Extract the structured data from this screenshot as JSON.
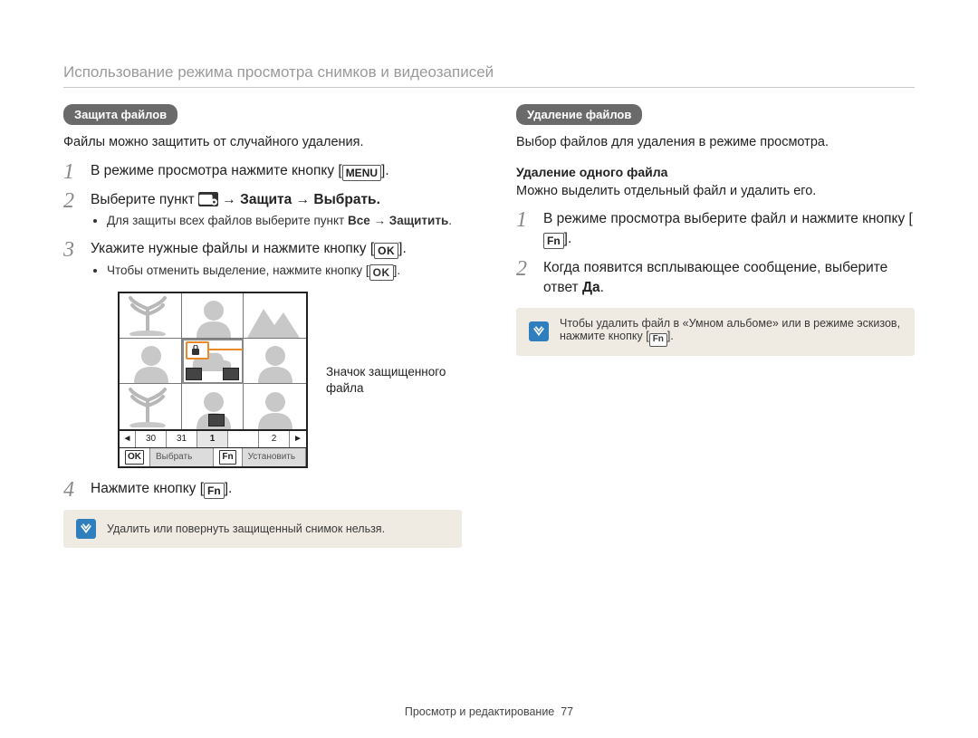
{
  "header": {
    "title": "Использование режима просмотра снимков и видеозаписей"
  },
  "left": {
    "pill": "Защита файлов",
    "intro": "Файлы можно защитить от случайного удаления.",
    "step1_a": "В режиме просмотра нажмите кнопку [",
    "step1_b": "].",
    "menu_label": "MENU",
    "step2_a": "Выберите пункт ",
    "step2_b": " → Защита → Выбрать.",
    "step2_sub_a": "Для защиты всех файлов выберите пункт ",
    "step2_sub_all": "Все",
    "step2_sub_arrow": " → ",
    "step2_sub_protect": "Защитить",
    "step2_sub_dot": ".",
    "step3_a": "Укажите нужные файлы и нажмите кнопку [",
    "step3_b": "].",
    "ok_label": "OK",
    "step3_sub_a": "Чтобы отменить выделение, нажмите кнопку [",
    "step3_sub_b": "].",
    "callout": "Значок защищенного файла",
    "timeline": {
      "t1": "30",
      "t2": "31",
      "t3": "1",
      "t4": "2"
    },
    "bar": {
      "ok": "OK",
      "select": "Выбрать",
      "fn": "Fn",
      "set": "Установить"
    },
    "step4_a": "Нажмите кнопку [",
    "step4_b": "].",
    "fn_label": "Fn",
    "note": "Удалить или повернуть защищенный снимок нельзя."
  },
  "right": {
    "pill": "Удаление файлов",
    "intro": "Выбор файлов для удаления в режиме просмотра.",
    "subhead": "Удаление одного файла",
    "subintro": "Можно выделить отдельный файл и удалить его.",
    "step1_a": "В режиме просмотра выберите файл и нажмите кнопку [",
    "step1_b": "].",
    "fn_label": "Fn",
    "step2_a": "Когда появится всплывающее сообщение, выберите ответ ",
    "step2_yes": "Да",
    "step2_b": ".",
    "note_a": "Чтобы удалить файл в «Умном альбоме» или в режиме эскизов, нажмите кнопку [",
    "note_b": "]."
  },
  "footer": {
    "section": "Просмотр и редактирование",
    "page": "77"
  }
}
